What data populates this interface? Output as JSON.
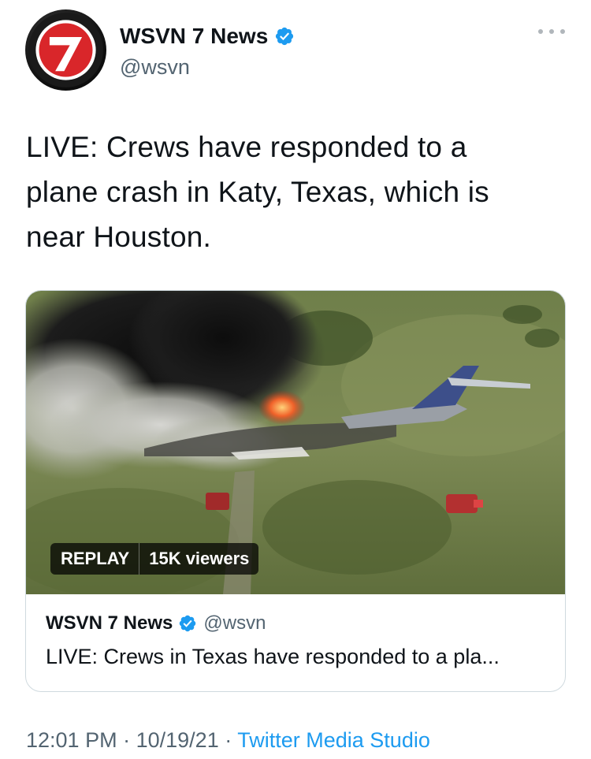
{
  "tweet": {
    "author": {
      "display_name": "WSVN 7 News",
      "handle": "@wsvn",
      "verified": true,
      "avatar_icon": "wsvn-7-logo"
    },
    "more_icon": "more-horizontal-icon",
    "text_lines": [
      "LIVE: Crews have responded to a",
      "plane crash in Katy, Texas, which is",
      "near Houston."
    ],
    "card": {
      "media": {
        "description_icon": "plane-crash-aerial-image"
      },
      "replay_label": "REPLAY",
      "viewers_label": "15K viewers",
      "author": {
        "display_name": "WSVN 7 News",
        "handle": "@wsvn"
      },
      "text": "LIVE: Crews in Texas have responded to a pla..."
    },
    "footer": {
      "time": "12:01 PM",
      "separator": "·",
      "date": "10/19/21",
      "source": "Twitter Media Studio"
    }
  },
  "colors": {
    "text": "#0f1419",
    "secondary": "#536471",
    "link": "#1d9bf0",
    "verified": "#1d9bf0",
    "border": "#cfd9de"
  }
}
